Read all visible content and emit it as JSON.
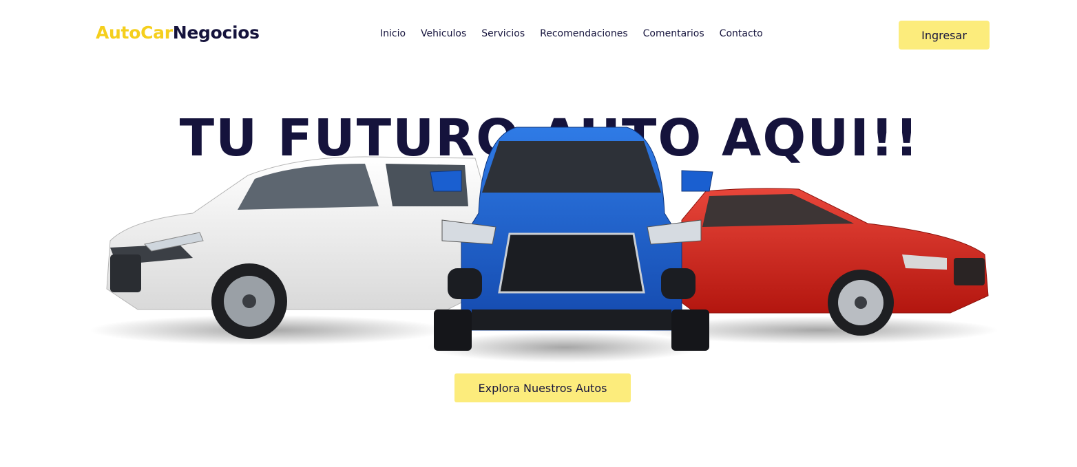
{
  "header": {
    "logo": {
      "part1": "AutoCar",
      "part2": "Negocios"
    },
    "nav": [
      {
        "label": "Inicio"
      },
      {
        "label": "Vehiculos"
      },
      {
        "label": "Servicios"
      },
      {
        "label": "Recomendaciones"
      },
      {
        "label": "Comentarios"
      },
      {
        "label": "Contacto"
      }
    ],
    "login_label": "Ingresar"
  },
  "hero": {
    "title": "TU FUTURO AUTO AQUI!!",
    "cta_label": "Explora Nuestros Autos",
    "image_icon": "three-cars-illustration"
  },
  "colors": {
    "brand_yellow": "#f5cf1d",
    "button_yellow": "#fcec7c",
    "navy": "#15133c",
    "car_white": "#f2f2f2",
    "car_blue": "#1a5fd0",
    "car_red": "#d8231b"
  }
}
